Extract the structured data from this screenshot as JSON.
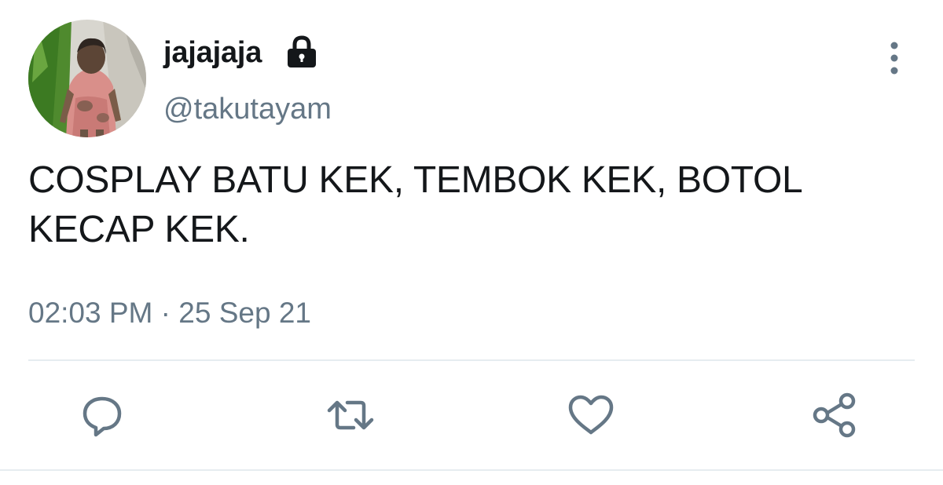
{
  "author": {
    "display_name": "jajajaja",
    "handle": "@takutayam",
    "protected_icon": "lock-icon",
    "avatar": "profile-photo"
  },
  "tweet": {
    "text": "COSPLAY BATU KEK, TEMBOK KEK, BOTOL KECAP KEK.",
    "time": "02:03 PM",
    "separator": "·",
    "date": "25 Sep 21"
  },
  "actions": [
    {
      "name": "reply",
      "icon": "comment-icon"
    },
    {
      "name": "retweet",
      "icon": "retweet-icon"
    },
    {
      "name": "like",
      "icon": "heart-icon"
    },
    {
      "name": "share",
      "icon": "share-icon"
    }
  ],
  "menu": {
    "icon": "more-vertical-icon"
  },
  "colors": {
    "text": "#14171a",
    "secondary": "#657786",
    "divider": "#e6ecf0"
  }
}
